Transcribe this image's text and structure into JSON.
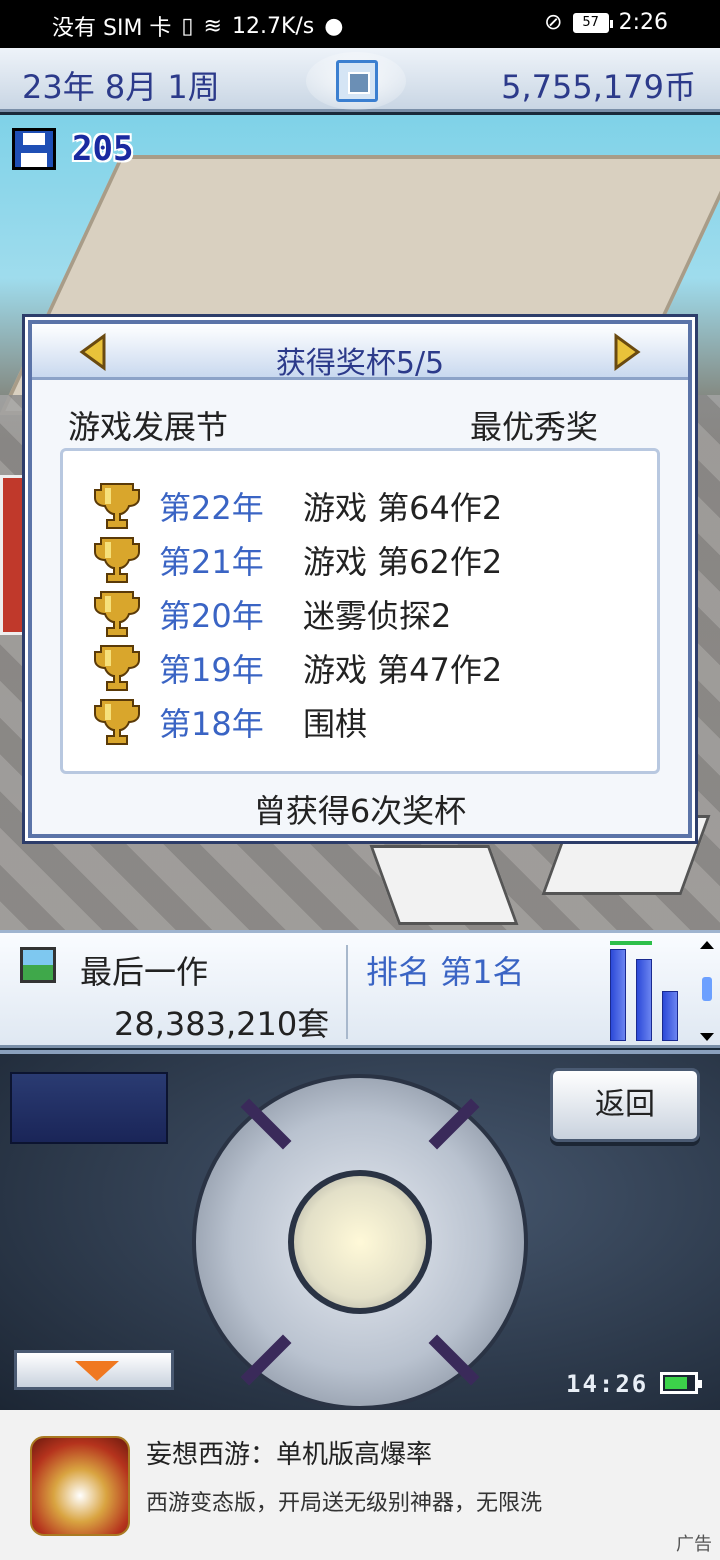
{
  "status_bar": {
    "carrier": "没有 SIM 卡",
    "network_speed": "12.7K/s",
    "battery_level": "57",
    "time": "2:26"
  },
  "top_bar": {
    "date": "23年 8月 1周",
    "money": "5,755,179币"
  },
  "save": {
    "count": "205"
  },
  "trophy_dialog": {
    "title": "获得奖杯5/5",
    "category": "游戏发展节",
    "award": "最优秀奖",
    "trophies": [
      {
        "year": "第22年",
        "game": "游戏 第64作2"
      },
      {
        "year": "第21年",
        "game": "游戏 第62作2"
      },
      {
        "year": "第20年",
        "game": "迷雾侦探2"
      },
      {
        "year": "第19年",
        "game": "游戏 第47作2"
      },
      {
        "year": "第18年",
        "game": "围棋"
      }
    ],
    "total": "曾获得6次奖杯"
  },
  "info_bar": {
    "last_work_label": "最后一作",
    "last_work_sales": "28,383,210套",
    "rank": "排名 第1名"
  },
  "controller": {
    "back_label": "返回",
    "clock": "14:26"
  },
  "ad": {
    "title": "妄想西游：单机版高爆率",
    "description": "西游变态版，开局送无级别神器，无限洗",
    "label": "广告"
  },
  "colors": {
    "accent_blue": "#2c3a8a",
    "year_blue": "#3a64c4",
    "dialog_border": "#5b74a8"
  }
}
